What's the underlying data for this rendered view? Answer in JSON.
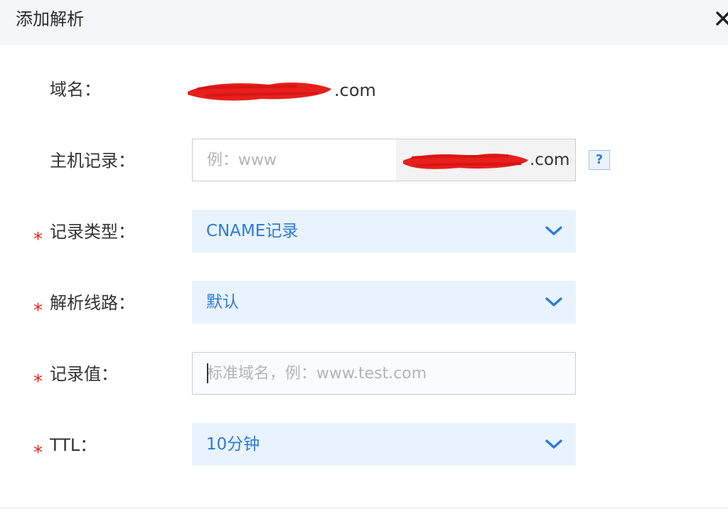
{
  "dialog": {
    "title": "添加解析",
    "close_icon": "close-icon"
  },
  "form": {
    "domain": {
      "label": "域名：",
      "suffix": ".com"
    },
    "host_record": {
      "label": "主机记录：",
      "placeholder": "例：www",
      "suffix": ".com",
      "help_text": "?"
    },
    "record_type": {
      "required_mark": "*",
      "label": "记录类型：",
      "selected": "CNAME记录",
      "icon": "chevron-down-icon"
    },
    "line": {
      "required_mark": "*",
      "label": "解析线路：",
      "selected": "默认",
      "icon": "chevron-down-icon"
    },
    "record_value": {
      "required_mark": "*",
      "label": "记录值：",
      "placeholder": "标准域名，例：www.test.com"
    },
    "ttl": {
      "required_mark": "*",
      "label": "TTL：",
      "selected": "10分钟",
      "icon": "chevron-down-icon"
    }
  },
  "colors": {
    "accent": "#2c7bd6",
    "required": "#e2231a",
    "select_bg": "#e8f3fd",
    "header_bg": "#f4f6f9",
    "redaction": "#e8201c"
  }
}
